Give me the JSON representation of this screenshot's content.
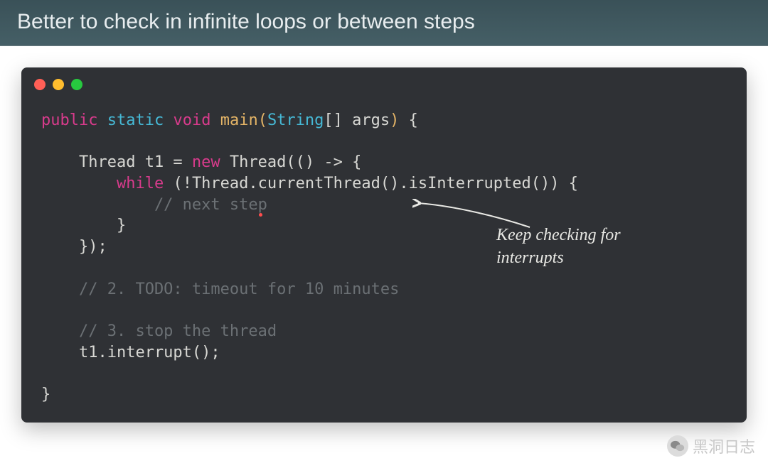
{
  "header": {
    "title": "Better to check in infinite loops or between steps"
  },
  "code": {
    "line1_public": "public",
    "line1_static": "static",
    "line1_void": "void",
    "line1_main": "main",
    "line1_paren_o": "(",
    "line1_type": "String",
    "line1_brackets": "[]",
    "line1_args": " args",
    "line1_paren_c": ")",
    "line1_brace": " {",
    "blank": "",
    "line2_a": "    Thread t1 = ",
    "line2_new": "new",
    "line2_b": " Thread(() -> {",
    "line3_indent": "        ",
    "line3_while": "while",
    "line3_rest": " (!Thread.currentThread().isInterrupted()) {",
    "line4": "            // next step",
    "line5": "        }",
    "line6": "    });",
    "line7": "    // 2. TODO: timeout for 10 minutes",
    "line8": "    // 3. stop the thread",
    "line9": "    t1.interrupt();",
    "line10": "}"
  },
  "annotation": {
    "line1": "Keep checking for",
    "line2": "interrupts"
  },
  "watermark": {
    "text": "黑洞日志"
  }
}
